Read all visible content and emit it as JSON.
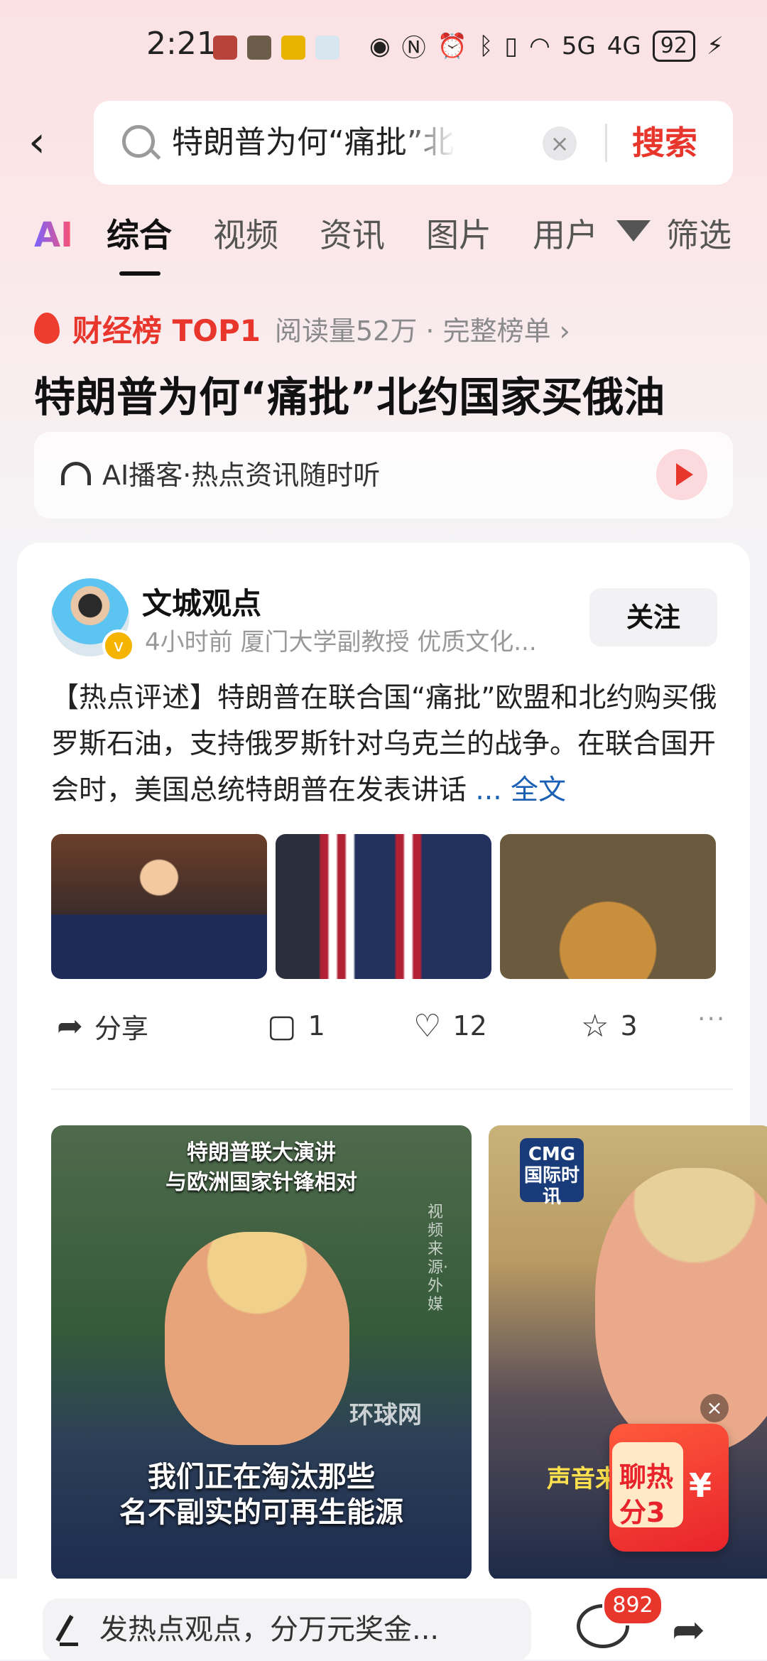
{
  "status_bar": {
    "time": "2:21",
    "network_5g": "5G",
    "network_4g": "4G",
    "battery": "92"
  },
  "search": {
    "query": "特朗普为何“痛批”北约国家买俄油",
    "clear_icon": "×",
    "button_label": "搜索"
  },
  "tabs": [
    {
      "label": "AI"
    },
    {
      "label": "综合"
    },
    {
      "label": "视频"
    },
    {
      "label": "资讯"
    },
    {
      "label": "图片"
    },
    {
      "label": "用户"
    }
  ],
  "filter_label": "筛选",
  "hot": {
    "rank_label": "财经榜 TOP1",
    "meta": "阅读量52万 · 完整榜单 ›",
    "headline": "特朗普为何“痛批”北约国家买俄油"
  },
  "podcast": {
    "text": "AI播客·热点资讯随时听"
  },
  "post": {
    "author": "文城观点",
    "meta": "4小时前  厦门大学副教授 优质文化...",
    "follow_label": "关注",
    "body": "【热点评述】特朗普在联合国“痛批”欧盟和北约购买俄罗斯石油，支持俄罗斯针对乌克兰的战争。在联合国开会时，美国总统特朗普在发表讲话 ",
    "read_more": "... 全文",
    "share_label": "分享",
    "comments": "1",
    "likes": "12",
    "favorites": "3",
    "more": "···"
  },
  "videos": [
    {
      "caption_top": "特朗普联大演讲\n与欧洲国家针锋相对",
      "caption_bottom": "我们正在淘汰那些\n名不副实的可再生能源",
      "watermark": "环球网",
      "source": "视频来源·外媒"
    },
    {
      "logo": "CMG\n国际时讯",
      "caption": "声音来"
    }
  ],
  "red_packet": {
    "text": "聊热\n分3",
    "yen": "¥",
    "close": "×"
  },
  "bottom_bar": {
    "placeholder": "发热点观点，分万元奖金...",
    "badge_count": "892"
  }
}
